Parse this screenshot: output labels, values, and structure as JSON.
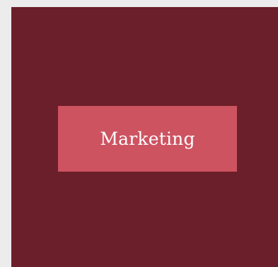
{
  "colors": {
    "page_background": "#ececec",
    "panel_background": "#6b1f2a",
    "button_background": "#cd5361",
    "button_text": "#ffffff"
  },
  "panel": {
    "button": {
      "label": "Marketing"
    }
  }
}
